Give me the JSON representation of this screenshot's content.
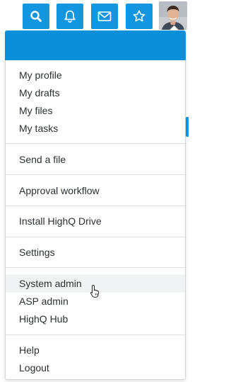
{
  "colors": {
    "accent": "#1396e0",
    "header_bar": "#0c8fd9",
    "hover_row": "#f2f3f4"
  },
  "topbar": {
    "buttons": [
      {
        "icon": "search-icon"
      },
      {
        "icon": "bell-icon"
      },
      {
        "icon": "envelope-icon"
      },
      {
        "icon": "star-icon"
      }
    ],
    "avatar": "user-avatar"
  },
  "menu": {
    "section1": [
      "My profile",
      "My drafts",
      "My files",
      "My tasks"
    ],
    "section2": [
      "Send a file"
    ],
    "section3": [
      "Approval workflow"
    ],
    "section4": [
      "Install HighQ Drive"
    ],
    "section5": [
      "Settings"
    ],
    "section6": [
      "System admin",
      "ASP admin",
      "HighQ Hub"
    ],
    "section7": [
      "Help",
      "Logout"
    ],
    "hovered_item": "System admin"
  }
}
